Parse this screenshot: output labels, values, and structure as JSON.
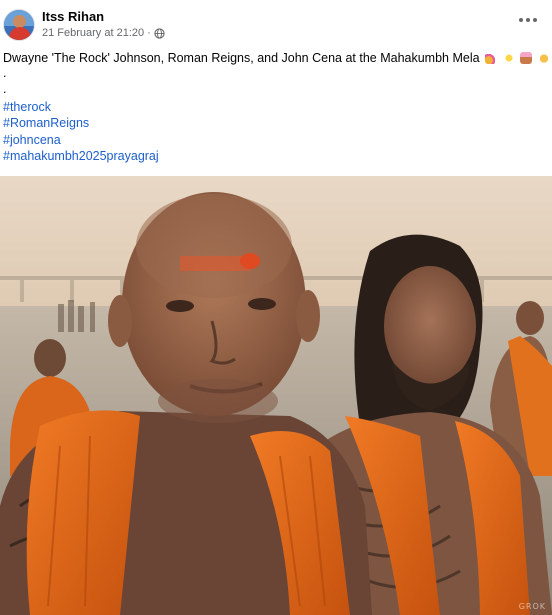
{
  "post": {
    "author": "Itss Rihan",
    "timestamp": "21 February at 21:20",
    "separator": "·",
    "privacy_icon": "globe-icon",
    "menu_icon": "more-options-icon",
    "caption": "Dwayne 'The Rock' Johnson, Roman Reigns, and John Cena at the Mahakumbh Mela",
    "emoji": [
      "party-popper",
      "sparkles",
      "cake",
      "clapping-hands"
    ],
    "dots": [
      ".",
      "."
    ],
    "hashtags": [
      "#therock",
      "#RomanReigns",
      "#johncena",
      "#mahakumbh2025prayagraj"
    ]
  },
  "photo": {
    "alt_subject": "three men in saffron scarves at a river bank at dawn",
    "watermark": "GROK"
  }
}
